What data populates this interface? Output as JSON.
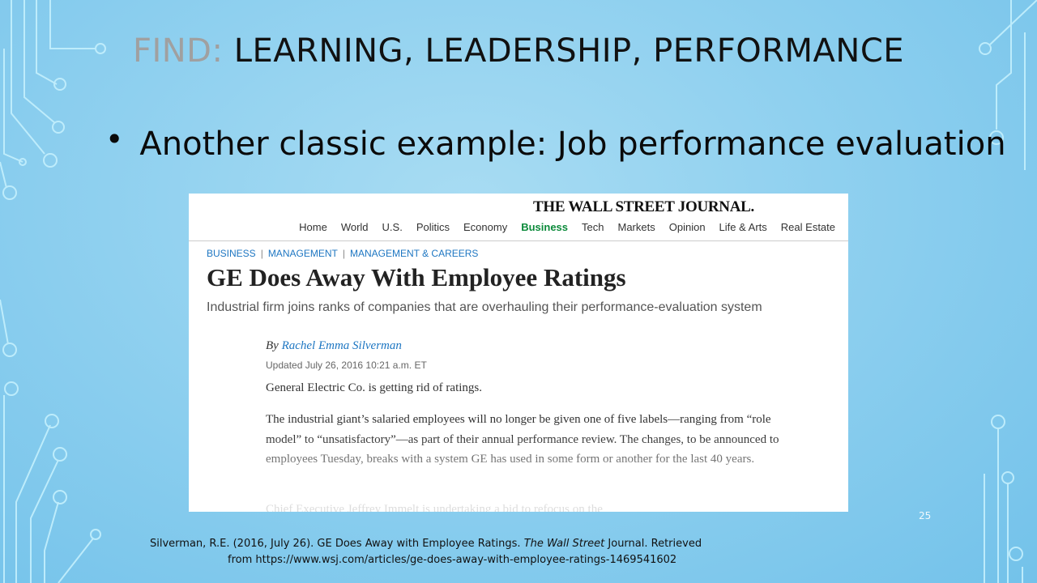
{
  "slide": {
    "title_prefix": "FIND:",
    "title_main": "LEARNING, LEADERSHIP, PERFORMANCE",
    "bullet_symbol": "•",
    "bullet_text": "Another classic example: Job performance evaluation",
    "page_number": "25",
    "citation_line1_a": "Silverman, R.E. (2016, July 26). GE Does Away with Employee Ratings.",
    "citation_line1_b": "The Wall Street",
    "citation_line1_c": "Journal. Retrieved",
    "citation_line2": "from https://www.wsj.com/articles/ge-does-away-with-employee-ratings-1469541602"
  },
  "article": {
    "masthead": "THE WALL STREET JOURNAL.",
    "nav": [
      "Home",
      "World",
      "U.S.",
      "Politics",
      "Economy",
      "Business",
      "Tech",
      "Markets",
      "Opinion",
      "Life & Arts",
      "Real Estate"
    ],
    "nav_active": "Business",
    "breadcrumbs": [
      "BUSINESS",
      "MANAGEMENT",
      "MANAGEMENT & CAREERS"
    ],
    "breadcrumb_sep": "|",
    "headline": "GE Does Away With Employee Ratings",
    "dek": "Industrial firm joins ranks of companies that are overhauling their performance-evaluation system",
    "by_prefix": "By",
    "author": "Rachel Emma Silverman",
    "updated": "Updated July 26, 2016 10:21 a.m. ET",
    "paragraph1": "General Electric Co. is getting rid of ratings.",
    "paragraph2": "The industrial giant’s salaried employees will no longer be given one of five labels—ranging from “role model” to “unsatisfactory”—as part of their annual performance review. The changes, to be announced to employees Tuesday, breaks with a system GE has used in some form or another for the last 40 years.",
    "paragraph3_partial": "Chief Executive Jeffrey Immelt is undertaking a bid to refocus on the"
  },
  "colors": {
    "background": "#8fd0ef",
    "circuit": "#bfeefc",
    "nav_active": "#0b8a3a",
    "link": "#1d76c2"
  }
}
